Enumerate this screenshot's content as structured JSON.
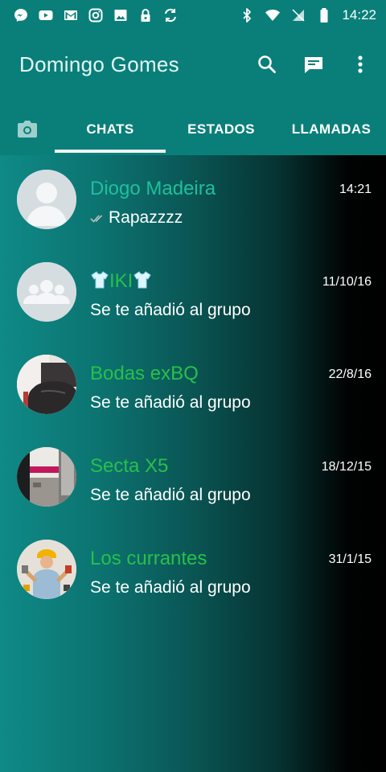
{
  "status_bar": {
    "time": "14:22",
    "left_icons": [
      "messenger-icon",
      "youtube-icon",
      "gmail-icon",
      "instagram-icon",
      "gallery-icon",
      "lock-icon",
      "sync-icon"
    ],
    "right_icons": [
      "bluetooth-icon",
      "wifi-icon",
      "no-sim-icon",
      "battery-icon"
    ]
  },
  "app_bar": {
    "title": "Domingo Gomes",
    "actions": [
      "search-icon",
      "new-chat-icon",
      "more-vert-icon"
    ]
  },
  "tabs": [
    {
      "label": "CHATS",
      "selected": true
    },
    {
      "label": "ESTADOS",
      "selected": false
    },
    {
      "label": "LLAMADAS",
      "selected": false
    }
  ],
  "chats": [
    {
      "name": "Diogo Madeira",
      "message": "Rapazzzz",
      "date": "14:21",
      "read_ticks": true,
      "avatar": "default-person"
    },
    {
      "name": "IKI",
      "name_icons": "shirt-icon",
      "message": "Se te añadió al grupo",
      "date": "11/10/16",
      "avatar": "default-group"
    },
    {
      "name": "Bodas exBQ",
      "message": "Se te añadió al grupo",
      "date": "22/8/16",
      "avatar": "photo"
    },
    {
      "name": "Secta X5",
      "message": "Se te añadió al grupo",
      "date": "18/12/15",
      "avatar": "photo"
    },
    {
      "name": "Los currantes",
      "message": "Se te añadió al grupo",
      "date": "31/1/15",
      "avatar": "photo"
    }
  ],
  "colors": {
    "toolbar": "#0a7f7a",
    "name_green": "#27c04b",
    "first_name": "#1fbf9c"
  }
}
